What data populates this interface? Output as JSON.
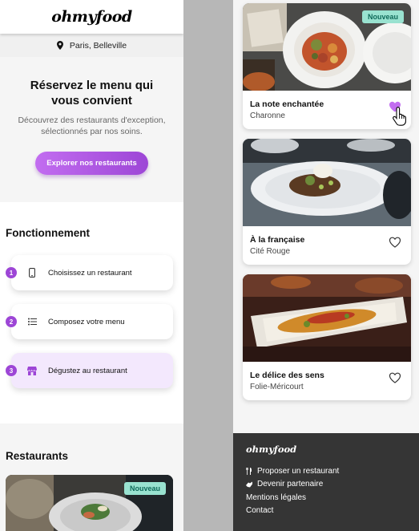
{
  "left": {
    "logo": "ohmyfood",
    "location": "Paris, Belleville",
    "hero": {
      "title": "Réservez le menu qui vous convient",
      "subtitle": "Découvrez des restaurants d'exception, sélectionnés par nos soins.",
      "cta": "Explorer nos restaurants"
    },
    "how": {
      "title": "Fonctionnement",
      "steps": [
        {
          "num": "1",
          "label": "Choisissez un restaurant",
          "icon": "mobile-phone-icon"
        },
        {
          "num": "2",
          "label": "Composez votre menu",
          "icon": "list-icon"
        },
        {
          "num": "3",
          "label": "Dégustez au restaurant",
          "icon": "store-icon"
        }
      ]
    },
    "restaurants": {
      "title": "Restaurants",
      "first_badge": "Nouveau"
    }
  },
  "right": {
    "cards": [
      {
        "name": "La note enchantée",
        "area": "Charonne",
        "badge": "Nouveau",
        "liked": true
      },
      {
        "name": "À la française",
        "area": "Cité Rouge",
        "liked": false
      },
      {
        "name": "Le délice des sens",
        "area": "Folie-Méricourt",
        "liked": false
      }
    ],
    "footer": {
      "logo": "ohmyfood",
      "links": [
        {
          "label": "Proposer un restaurant",
          "icon": "utensils-icon"
        },
        {
          "label": "Devenir partenaire",
          "icon": "handshake-icon"
        },
        {
          "label": "Mentions légales"
        },
        {
          "label": "Contact"
        }
      ]
    }
  },
  "colors": {
    "accent": "#9d46d6",
    "accent_light": "#c26df0",
    "badge_bg": "#99e2d0",
    "footer_bg": "#353535"
  }
}
